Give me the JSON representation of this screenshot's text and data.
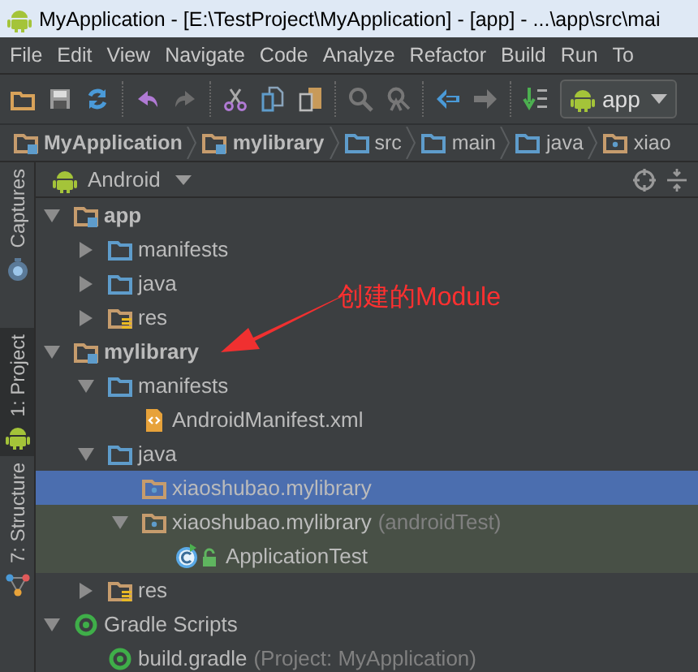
{
  "window": {
    "title": "MyApplication - [E:\\TestProject\\MyApplication] - [app] - ...\\app\\src\\mai"
  },
  "menu": [
    "File",
    "Edit",
    "View",
    "Navigate",
    "Code",
    "Analyze",
    "Refactor",
    "Build",
    "Run",
    "To"
  ],
  "toolbar": {
    "buttons": [
      {
        "kind": "open"
      },
      {
        "kind": "save"
      },
      {
        "kind": "sync"
      },
      {
        "kind": "sep"
      },
      {
        "kind": "undo"
      },
      {
        "kind": "redo"
      },
      {
        "kind": "sep"
      },
      {
        "kind": "cut"
      },
      {
        "kind": "copy"
      },
      {
        "kind": "paste"
      },
      {
        "kind": "sep"
      },
      {
        "kind": "find"
      },
      {
        "kind": "replace"
      },
      {
        "kind": "sep"
      },
      {
        "kind": "back"
      },
      {
        "kind": "forward"
      },
      {
        "kind": "sep"
      },
      {
        "kind": "make"
      }
    ],
    "run_config": "app"
  },
  "breadcrumbs": [
    {
      "label": "MyApplication",
      "kind": "module"
    },
    {
      "label": "mylibrary",
      "kind": "module"
    },
    {
      "label": "src",
      "kind": "folder"
    },
    {
      "label": "main",
      "kind": "folder"
    },
    {
      "label": "java",
      "kind": "source"
    },
    {
      "label": "xiao",
      "kind": "package"
    }
  ],
  "side_tabs": [
    {
      "label": "Captures",
      "kind": "captures",
      "selected": false
    },
    {
      "label": "1: Project",
      "kind": "project",
      "selected": true
    },
    {
      "label": "7: Structure",
      "kind": "structure",
      "selected": false
    }
  ],
  "panel": {
    "view": "Android"
  },
  "tree": [
    {
      "label": "app",
      "kind": "module",
      "expanded": true,
      "selected": false,
      "children": [
        {
          "label": "manifests",
          "kind": "folder",
          "expanded": false,
          "selected": false
        },
        {
          "label": "java",
          "kind": "folder",
          "expanded": false,
          "selected": false
        },
        {
          "label": "res",
          "kind": "res",
          "expanded": false,
          "selected": false
        }
      ]
    },
    {
      "label": "mylibrary",
      "kind": "module",
      "expanded": true,
      "selected": false,
      "children": [
        {
          "label": "manifests",
          "kind": "folder",
          "expanded": true,
          "selected": false,
          "children": [
            {
              "label": "AndroidManifest.xml",
              "kind": "manifest",
              "selected": false
            }
          ]
        },
        {
          "label": "java",
          "kind": "folder",
          "expanded": true,
          "selected": false,
          "children": [
            {
              "label": "xiaoshubao.mylibrary",
              "kind": "package",
              "selected": true
            },
            {
              "label": "xiaoshubao.mylibrary",
              "note": "(androidTest)",
              "kind": "package",
              "expanded": true,
              "test": true,
              "selected": false,
              "children": [
                {
                  "label": "ApplicationTest",
                  "kind": "class",
                  "test": true,
                  "selected": false
                }
              ]
            }
          ]
        },
        {
          "label": "res",
          "kind": "res",
          "expanded": false,
          "selected": false
        }
      ]
    },
    {
      "label": "Gradle Scripts",
      "kind": "gradle",
      "expanded": true,
      "selected": false,
      "children": [
        {
          "label": "build.gradle",
          "note": "(Project: MyApplication)",
          "kind": "gradle-file",
          "selected": false
        }
      ]
    }
  ],
  "annotation": {
    "text": "创建的Module"
  }
}
